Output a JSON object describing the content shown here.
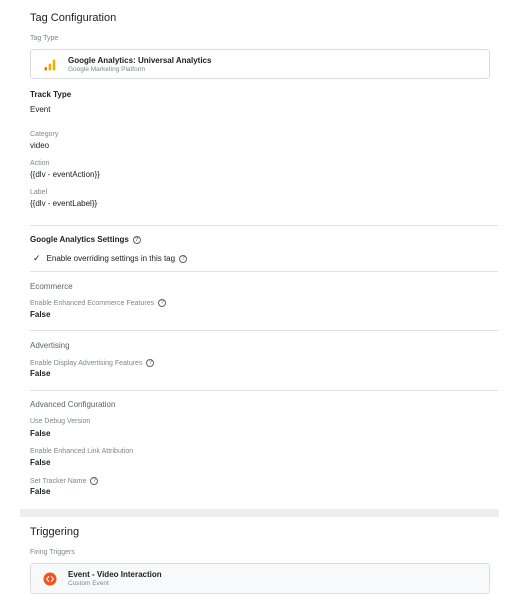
{
  "tag_configuration": {
    "title": "Tag Configuration",
    "tag_type_label": "Tag Type",
    "tag_type_card": {
      "icon": "google-analytics-bars-icon",
      "name": "Google Analytics: Universal Analytics",
      "provider": "Google Marketing Platform"
    },
    "track_type_label": "Track Type",
    "track_type_value": "Event",
    "fields": [
      {
        "label": "Category",
        "value": "video"
      },
      {
        "label": "Action",
        "value": "{{dlv - eventAction}}"
      },
      {
        "label": "Label",
        "value": "{{dlv - eventLabel}}"
      }
    ],
    "ga_settings": {
      "title": "Google Analytics Settings",
      "override_text": "Enable overriding settings in this tag"
    },
    "ecommerce": {
      "title": "Ecommerce",
      "label": "Enable Enhanced Ecommerce Features",
      "value": "False"
    },
    "advertising": {
      "title": "Advertising",
      "label": "Enable Display Advertising Features",
      "value": "False"
    },
    "advanced": {
      "title": "Advanced Configuration",
      "fields": [
        {
          "label": "Use Debug Version",
          "value": "False"
        },
        {
          "label": "Enable Enhanced Link Attribution",
          "value": "False"
        },
        {
          "label": "Set Tracker Name",
          "value": "False"
        }
      ]
    }
  },
  "triggering": {
    "title": "Triggering",
    "firing_label": "Firing Triggers",
    "trigger_card": {
      "icon": "custom-event-icon",
      "name": "Event - Video Interaction",
      "type": "Custom Event"
    }
  },
  "colors": {
    "ga_orange": "#f9ab00",
    "ga_dark_orange": "#e37400",
    "trigger_icon": "#f4511e"
  }
}
